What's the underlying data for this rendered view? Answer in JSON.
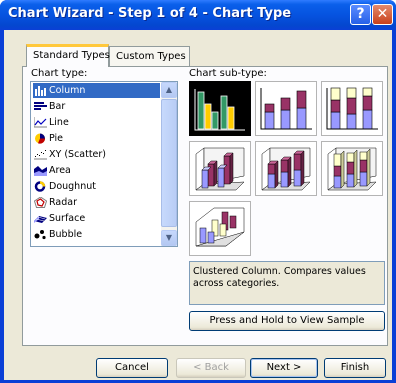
{
  "window": {
    "title": "Chart Wizard - Step 1 of 4 - Chart Type",
    "help_glyph": "?",
    "close_glyph": "✕"
  },
  "tabs": [
    {
      "label": "Standard Types",
      "active": true
    },
    {
      "label": "Custom Types",
      "active": false
    }
  ],
  "chart_type": {
    "label": "Chart type:",
    "items": [
      {
        "label": "Column",
        "icon": "column-chart-icon",
        "selected": true
      },
      {
        "label": "Bar",
        "icon": "bar-chart-icon"
      },
      {
        "label": "Line",
        "icon": "line-chart-icon"
      },
      {
        "label": "Pie",
        "icon": "pie-chart-icon"
      },
      {
        "label": "XY (Scatter)",
        "icon": "scatter-chart-icon"
      },
      {
        "label": "Area",
        "icon": "area-chart-icon"
      },
      {
        "label": "Doughnut",
        "icon": "doughnut-chart-icon"
      },
      {
        "label": "Radar",
        "icon": "radar-chart-icon"
      },
      {
        "label": "Surface",
        "icon": "surface-chart-icon"
      },
      {
        "label": "Bubble",
        "icon": "bubble-chart-icon"
      }
    ]
  },
  "subtype": {
    "label": "Chart sub-type:",
    "items": [
      {
        "name": "clustered-column",
        "selected": true
      },
      {
        "name": "stacked-column"
      },
      {
        "name": "100-stacked-column"
      },
      {
        "name": "3d-clustered-column"
      },
      {
        "name": "3d-stacked-column"
      },
      {
        "name": "3d-100-stacked-column"
      },
      {
        "name": "3d-column"
      }
    ],
    "description": "Clustered Column. Compares values across categories."
  },
  "buttons": {
    "sample": "Press and Hold to View Sample",
    "cancel": "Cancel",
    "back": "< Back",
    "next": "Next >",
    "finish": "Finish"
  },
  "colors": {
    "titlebar": "#0a5fea",
    "face": "#ece9d8",
    "selection": "#316ac5",
    "series1": "#9999ff",
    "series2": "#993366",
    "series3": "#ffffcc",
    "column_green": "#339966"
  }
}
